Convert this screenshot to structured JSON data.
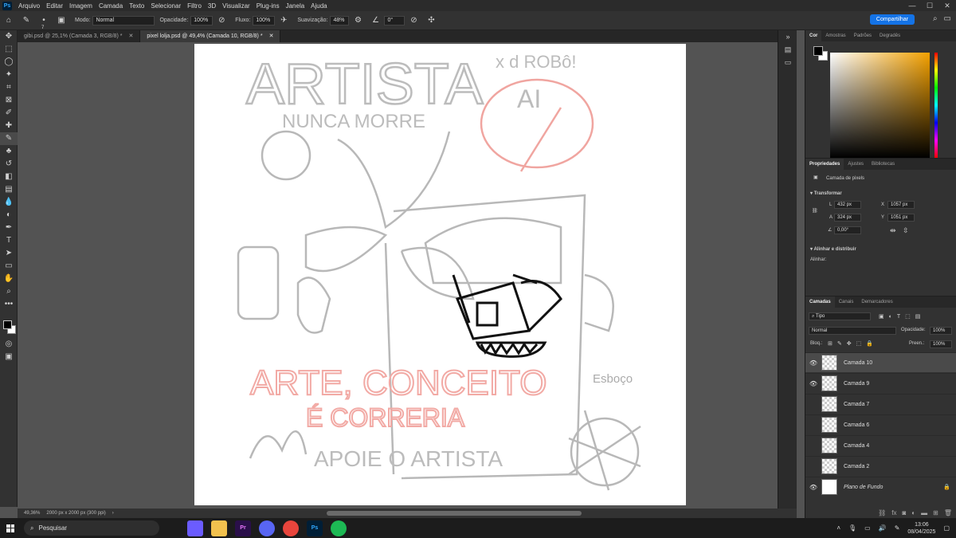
{
  "menubar": {
    "items": [
      "Arquivo",
      "Editar",
      "Imagem",
      "Camada",
      "Texto",
      "Selecionar",
      "Filtro",
      "3D",
      "Visualizar",
      "Plug-ins",
      "Janela",
      "Ajuda"
    ]
  },
  "options": {
    "brush_size": "7",
    "mode_label": "Modo:",
    "mode_value": "Normal",
    "opacity_label": "Opacidade:",
    "opacity_value": "100%",
    "flow_label": "Fluxo:",
    "flow_value": "100%",
    "smoothing_label": "Suavização:",
    "smoothing_value": "48%",
    "angle_value": "0°",
    "share_label": "Compartilhar"
  },
  "tabs": [
    {
      "label": "gibi.psd @ 25,1% (Camada 3, RGB/8) *",
      "active": false
    },
    {
      "label": "pixel lolja.psd @ 49,4% (Camada 10, RGB/8) *",
      "active": true
    }
  ],
  "status": {
    "zoom": "49,36%",
    "doc_info": "2000 px x 2000 px (300 ppi)"
  },
  "color_panel": {
    "tabs": [
      "Cor",
      "Amostras",
      "Padrões",
      "Degradês"
    ],
    "accent": "#f4a100"
  },
  "properties": {
    "tabs": [
      "Propriedades",
      "Ajustes",
      "Bibliotecas"
    ],
    "layer_type": "Camada de pixels",
    "transform_title": "Transformar",
    "w_label": "L",
    "w": "432 px",
    "h_label": "A",
    "h": "324 px",
    "x_label": "X",
    "x": "1057 px",
    "y_label": "Y",
    "y": "1051 px",
    "angle": "0,00°",
    "align_title": "Alinhar e distribuir",
    "align_label": "Alinhar:"
  },
  "layers": {
    "tabs": [
      "Camadas",
      "Canais",
      "Demarcadores"
    ],
    "filter": "Tipo",
    "blend": "Normal",
    "opacity_label": "Opacidade:",
    "opacity": "100%",
    "lock_label": "Bloq.:",
    "fill_label": "Preen.:",
    "fill": "100%",
    "items": [
      {
        "name": "Camada 10",
        "visible": true,
        "active": true
      },
      {
        "name": "Camada 9",
        "visible": true,
        "active": false
      },
      {
        "name": "Camada 7",
        "visible": false,
        "active": false
      },
      {
        "name": "Camada 6",
        "visible": false,
        "active": false
      },
      {
        "name": "Camada 4",
        "visible": false,
        "active": false
      },
      {
        "name": "Camada 2",
        "visible": false,
        "active": false
      },
      {
        "name": "Plano de Fundo",
        "visible": true,
        "active": false,
        "background": true
      }
    ]
  },
  "taskbar": {
    "search_placeholder": "Pesquisar",
    "apps": [
      {
        "label": "",
        "color": "#6b5cff"
      },
      {
        "label": "",
        "color": "#f2c14e"
      },
      {
        "label": "Pr",
        "color": "#2a0f4a"
      },
      {
        "label": "",
        "color": "#5865f2"
      },
      {
        "label": "",
        "color": "#e8453c"
      },
      {
        "label": "Ps",
        "color": "#001e36"
      },
      {
        "label": "",
        "color": "#1db954"
      }
    ],
    "time": "13:06",
    "date": "08/04/2025"
  },
  "artwork": {
    "t1": "ARTISTA",
    "t2": "x d ROBô!",
    "t3": "NUNCA MORRE",
    "t4": "AI",
    "t5": "ARTE, CONCEITO",
    "t6": "É CORRERIA",
    "t7": "APOIE O ARTISTA",
    "t8": "Esboço"
  }
}
